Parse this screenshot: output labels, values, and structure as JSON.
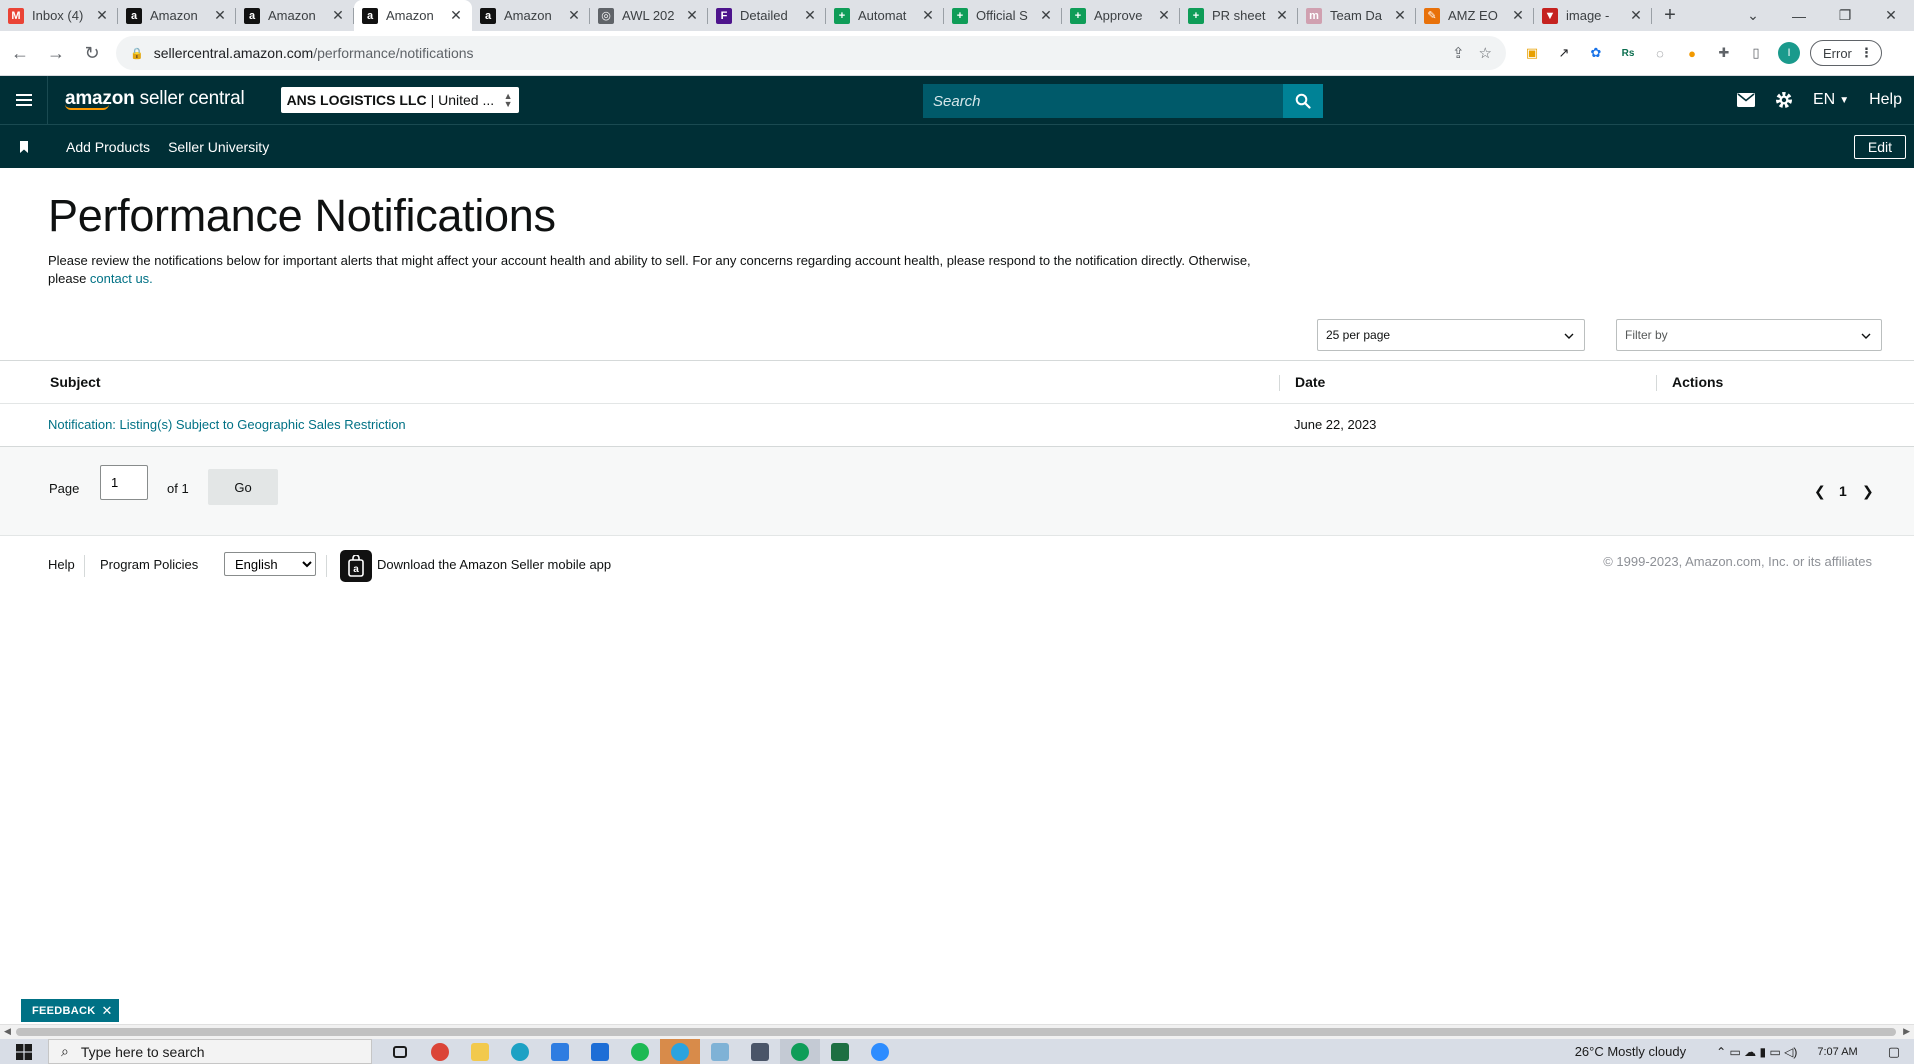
{
  "browser": {
    "tabs": [
      {
        "title": "Inbox (4)",
        "color": "#ea4335",
        "glyph": "M"
      },
      {
        "title": "Amazon",
        "color": "#111111",
        "glyph": "a"
      },
      {
        "title": "Amazon",
        "color": "#111111",
        "glyph": "a"
      },
      {
        "title": "Amazon",
        "color": "#111111",
        "glyph": "a",
        "active": true
      },
      {
        "title": "Amazon",
        "color": "#111111",
        "glyph": "a"
      },
      {
        "title": "AWL 202",
        "color": "#5f6368",
        "glyph": "◎"
      },
      {
        "title": "Detailed",
        "color": "#4d148c",
        "glyph": "F"
      },
      {
        "title": "Automat",
        "color": "#0f9d58",
        "glyph": "+"
      },
      {
        "title": "Official S",
        "color": "#0f9d58",
        "glyph": "+"
      },
      {
        "title": "Approve",
        "color": "#0f9d58",
        "glyph": "+"
      },
      {
        "title": "PR sheet",
        "color": "#0f9d58",
        "glyph": "+"
      },
      {
        "title": "Team Da",
        "color": "#d0a0b0",
        "glyph": "m"
      },
      {
        "title": "AMZ EO",
        "color": "#e8710a",
        "glyph": "✎"
      },
      {
        "title": "image - ",
        "color": "#c5221f",
        "glyph": "▼"
      }
    ],
    "url_host": "sellercentral.amazon.com",
    "url_path": "/performance/notifications",
    "profile_initial": "I",
    "error_label": "Error"
  },
  "header": {
    "logo_brand": "amazon",
    "logo_product": "seller central",
    "account_name": "ANS LOGISTICS LLC",
    "account_region": "| United ...",
    "search_placeholder": "Search",
    "language": "EN",
    "help": "Help"
  },
  "subnav": {
    "items": [
      "Add Products",
      "Seller University"
    ],
    "edit_label": "Edit"
  },
  "main": {
    "title": "Performance Notifications",
    "intro_text": "Please review the notifications below for important alerts that might affect your account health and ability to sell. For any concerns regarding account health, please respond to the notification directly. Otherwise, please ",
    "intro_link": "contact us.",
    "per_page": "25 per page",
    "filter_placeholder": "Filter by",
    "columns": {
      "subject": "Subject",
      "date": "Date",
      "actions": "Actions"
    },
    "rows": [
      {
        "subject": "Notification: Listing(s) Subject to Geographic Sales Restriction",
        "date": "June 22, 2023"
      }
    ]
  },
  "pagination": {
    "page_label": "Page",
    "page_value": "1",
    "of_label": "of 1",
    "go_label": "Go",
    "current_page": "1"
  },
  "footer": {
    "help": "Help",
    "program_policies": "Program Policies",
    "language": "English",
    "app_text": "Download the Amazon Seller mobile app",
    "copyright": "© 1999-2023, Amazon.com, Inc. or its affiliates"
  },
  "feedback_label": "FEEDBACK",
  "taskbar": {
    "search_placeholder": "Type here to search",
    "weather": "26°C  Mostly cloudy",
    "time": "7:07 AM"
  },
  "colors": {
    "header_bg": "#002f36",
    "search_btn": "#008296",
    "link": "#007185"
  }
}
